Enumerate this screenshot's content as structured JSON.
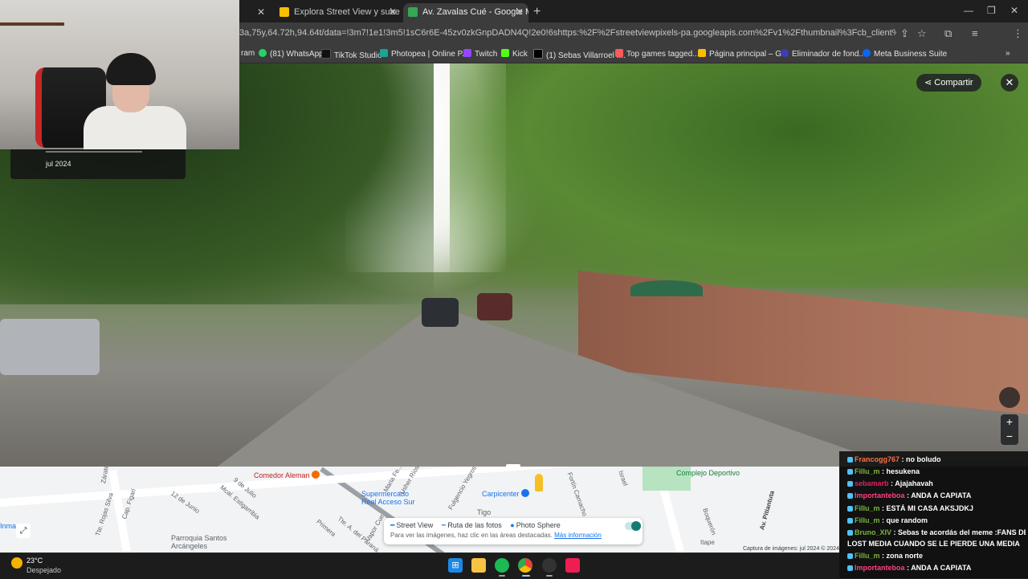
{
  "browser": {
    "tabs": [
      {
        "label": "",
        "active": false
      },
      {
        "label": "Explora Street View y sube tus i",
        "active": false
      },
      {
        "label": "Av. Zavalas Cué - Google Maps",
        "active": true
      }
    ],
    "url": "3a,75y,64.72h,94.64t/data=!3m7!1e1!3m5!1sC6r6E-45zv0zkGnpDADN4Q!2e0!6shttps:%2F%2Fstreetviewpixels-pa.googleapis.com%2Fv1%2Fthumbnail%3Fcb_client%3Dmaps_sv.tactile%26w%3D90...",
    "bookmarks": [
      {
        "label": "ram"
      },
      {
        "label": "(81) WhatsApp",
        "color": "#25d366"
      },
      {
        "label": "TikTok Studio",
        "color": "#111111"
      },
      {
        "label": "Photopea | Online P...",
        "color": "#18a497"
      },
      {
        "label": "Twitch",
        "color": "#9146ff"
      },
      {
        "label": "Kick",
        "color": "#53fc18"
      },
      {
        "label": "(1) Sebas Villarroel :...",
        "color": "#000000"
      },
      {
        "label": "Top games tagged...",
        "color": "#fa5c5c"
      },
      {
        "label": "Página principal – G...",
        "color": "#fbbc04"
      },
      {
        "label": "Eliminador de fond...",
        "color": "#3d3db8"
      },
      {
        "label": "Meta Business Suite",
        "color": "#0866ff"
      }
    ]
  },
  "streetview": {
    "share_label": "Compartir",
    "close_label": "✕",
    "date_label": "jul 2024",
    "zoom_in": "+",
    "zoom_out": "−"
  },
  "map": {
    "labels": [
      "Zárate",
      "12 de Junio",
      "Mcal. Estigarribia",
      "9 de Julio",
      "Tte. Rojas Silva",
      "Cap. Figari",
      "Parroquia Santos Arcángeles",
      "Primera",
      "Tte. A. del Paraná",
      "Vapor Cue",
      "Maria Fe...",
      "Usher Ríos",
      "Fulgencio Yegros",
      "Tigo",
      "Fortín Camacho",
      "Israel",
      "Boquerón",
      "Itape",
      "Av. Pitiantuta",
      "Complejo Deportivo",
      "Inma..."
    ],
    "pois": [
      {
        "label": "Comedor Aleman",
        "color": "#ef6c00"
      },
      {
        "label": "Supermercado Real Acceso Sur",
        "color": "#1a73e8"
      },
      {
        "label": "Carpicenter",
        "color": "#1a73e8"
      }
    ],
    "legend": {
      "items": [
        "Street View",
        "Ruta de las fotos",
        "Photo Sphere"
      ],
      "hint": "Para ver las imágenes, haz clic en las áreas destacadas.",
      "link": "Más información"
    },
    "credit": "Captura de imágenes: jul 2024   © 2024"
  },
  "chat": [
    {
      "user": "Francogg767",
      "text": "no boludo",
      "color": "#ff7043"
    },
    {
      "user": "Fillu_m",
      "text": "hesukena",
      "color": "#7cb342"
    },
    {
      "user": "sebamarb",
      "text": "Ajajahavah",
      "color": "#e91e63"
    },
    {
      "user": "Importanteboa",
      "text": "ANDA A CAPIATA",
      "color": "#ff4081"
    },
    {
      "user": "Fillu_m",
      "text": "ESTÁ MI CASA AKSJDKJ",
      "color": "#7cb342"
    },
    {
      "user": "Fillu_m",
      "text": "que random",
      "color": "#7cb342"
    },
    {
      "user": "Bruno_XIV",
      "text": "Sebas te acordás del meme :FANS DE",
      "color": "#7cb342"
    },
    {
      "user": "",
      "text": "LOST MEDIA CUANDO SE LE PIERDE UNA MEDIA",
      "color": "#7cb342"
    },
    {
      "user": "Fillu_m",
      "text": "zona norte",
      "color": "#7cb342"
    },
    {
      "user": "Importanteboa",
      "text": "ANDA A CAPIATA",
      "color": "#ff4081"
    }
  ],
  "taskbar": {
    "temperature": "23°C",
    "weather": "Despejado",
    "apps": [
      "start-icon",
      "files-icon",
      "spotify-icon",
      "chrome-icon",
      "obs-icon",
      "tiktok-icon"
    ]
  }
}
